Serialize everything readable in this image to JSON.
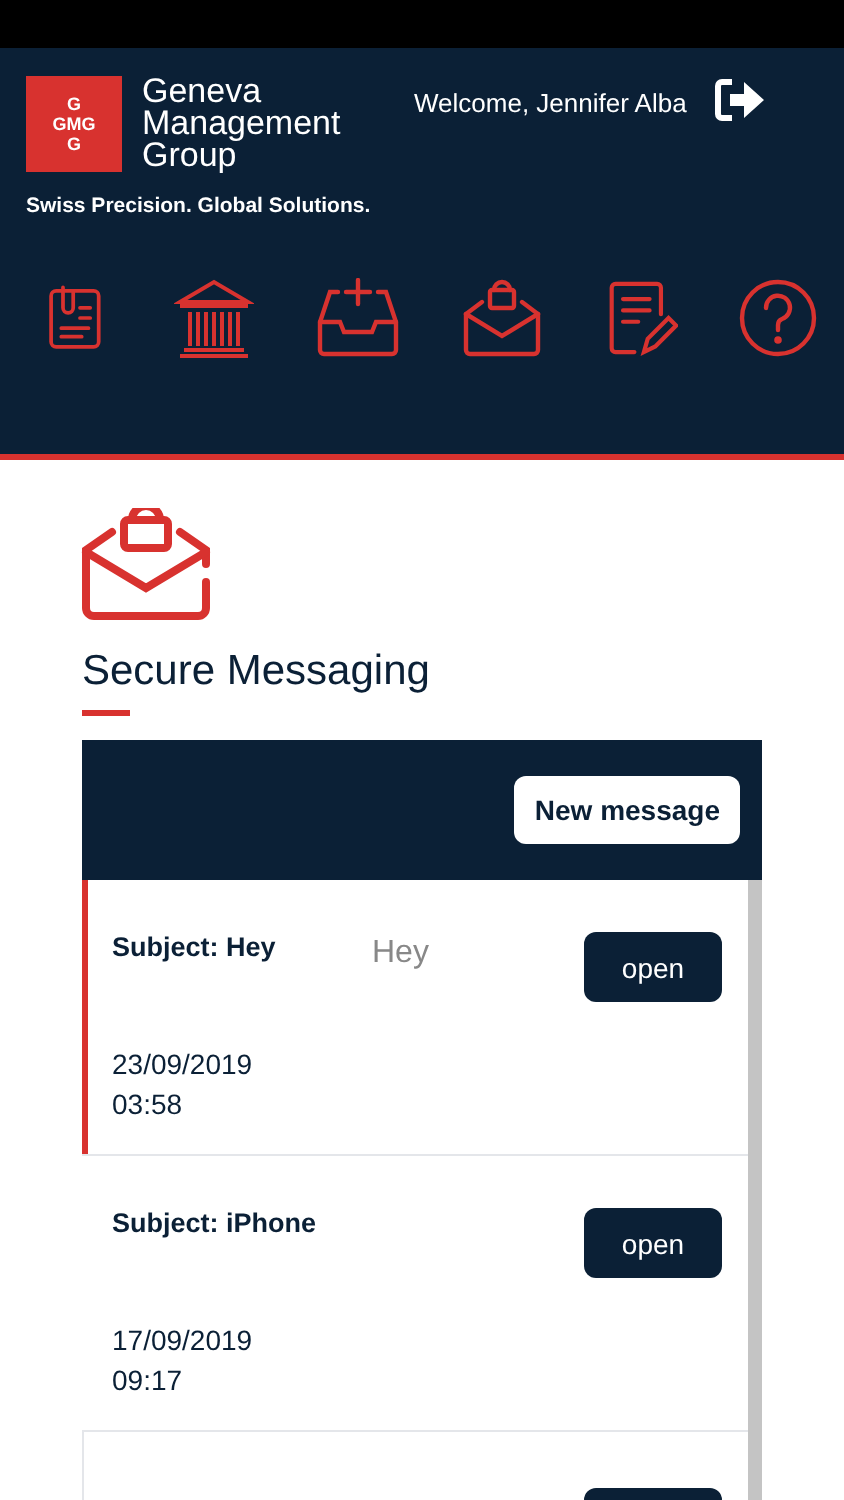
{
  "header": {
    "logo_letters": [
      "G",
      "GMG",
      "G"
    ],
    "company": [
      "Geneva",
      "Management",
      "Group"
    ],
    "tagline": "Swiss Precision. Global Solutions.",
    "welcome": "Welcome, Jennifer Alba"
  },
  "nav_icons": [
    {
      "kind": "document"
    },
    {
      "kind": "bank"
    },
    {
      "kind": "inbox"
    },
    {
      "kind": "secure-mail"
    },
    {
      "kind": "edit"
    },
    {
      "kind": "help"
    }
  ],
  "page": {
    "title": "Secure Messaging"
  },
  "messages_panel": {
    "new_button": "New message",
    "messages": [
      {
        "subject": "Subject: Hey",
        "preview": "Hey",
        "date": "23/09/2019",
        "time": "03:58",
        "button": "open",
        "selected": true
      },
      {
        "subject": "Subject: iPhone",
        "date": "17/09/2019",
        "time": "09:17",
        "button": "open",
        "selected": false
      }
    ]
  }
}
